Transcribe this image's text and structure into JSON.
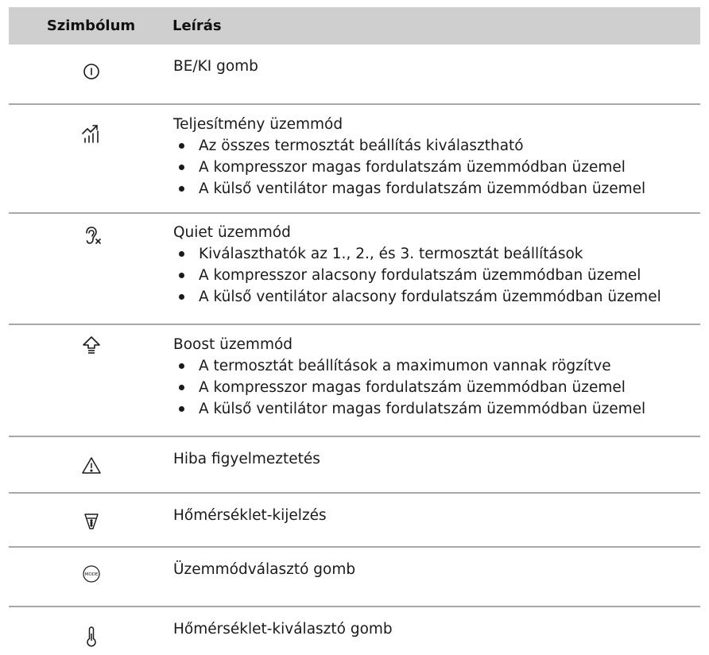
{
  "header": {
    "symbol": "Szimbólum",
    "description": "Leírás"
  },
  "rows": [
    {
      "icon": "power-icon",
      "title": "BE/KI gomb",
      "bullets": []
    },
    {
      "icon": "performance-chart-icon",
      "title": "Teljesítmény üzemmód",
      "bullets": [
        "Az összes termosztát beállítás kiválasztható",
        "A kompresszor magas fordulatszám üzemmódban üzemel",
        "A külső ventilátor magas fordulatszám üzemmódban üzemel"
      ]
    },
    {
      "icon": "quiet-ear-icon",
      "title": "Quiet üzemmód",
      "bullets": [
        "Kiválaszthatók az 1., 2., és 3. termosztát beállítások",
        "A kompresszor alacsony fordulatszám üzemmódban üzemel",
        "A külső ventilátor alacsony fordulatszám üzemmódban üzemel"
      ]
    },
    {
      "icon": "boost-arrow-icon",
      "title": "Boost üzemmód",
      "bullets": [
        "A termosztát beállítások a maximumon vannak rögzítve",
        "A kompresszor magas fordulatszám üzemmódban üzemel",
        "A külső ventilátor magas fordulatszám üzemmódban üzemel"
      ]
    },
    {
      "icon": "warning-triangle-icon",
      "title": "Hiba figyelmeztetés",
      "bullets": []
    },
    {
      "icon": "temperature-scale-icon",
      "title": "Hőmérséklet-kijelzés",
      "bullets": []
    },
    {
      "icon": "mode-button-icon",
      "icon_text": "MODE",
      "title": "Üzemmódválasztó gomb",
      "bullets": []
    },
    {
      "icon": "thermometer-icon",
      "title": "Hőmérséklet-kiválasztó gomb",
      "bullets": []
    }
  ]
}
